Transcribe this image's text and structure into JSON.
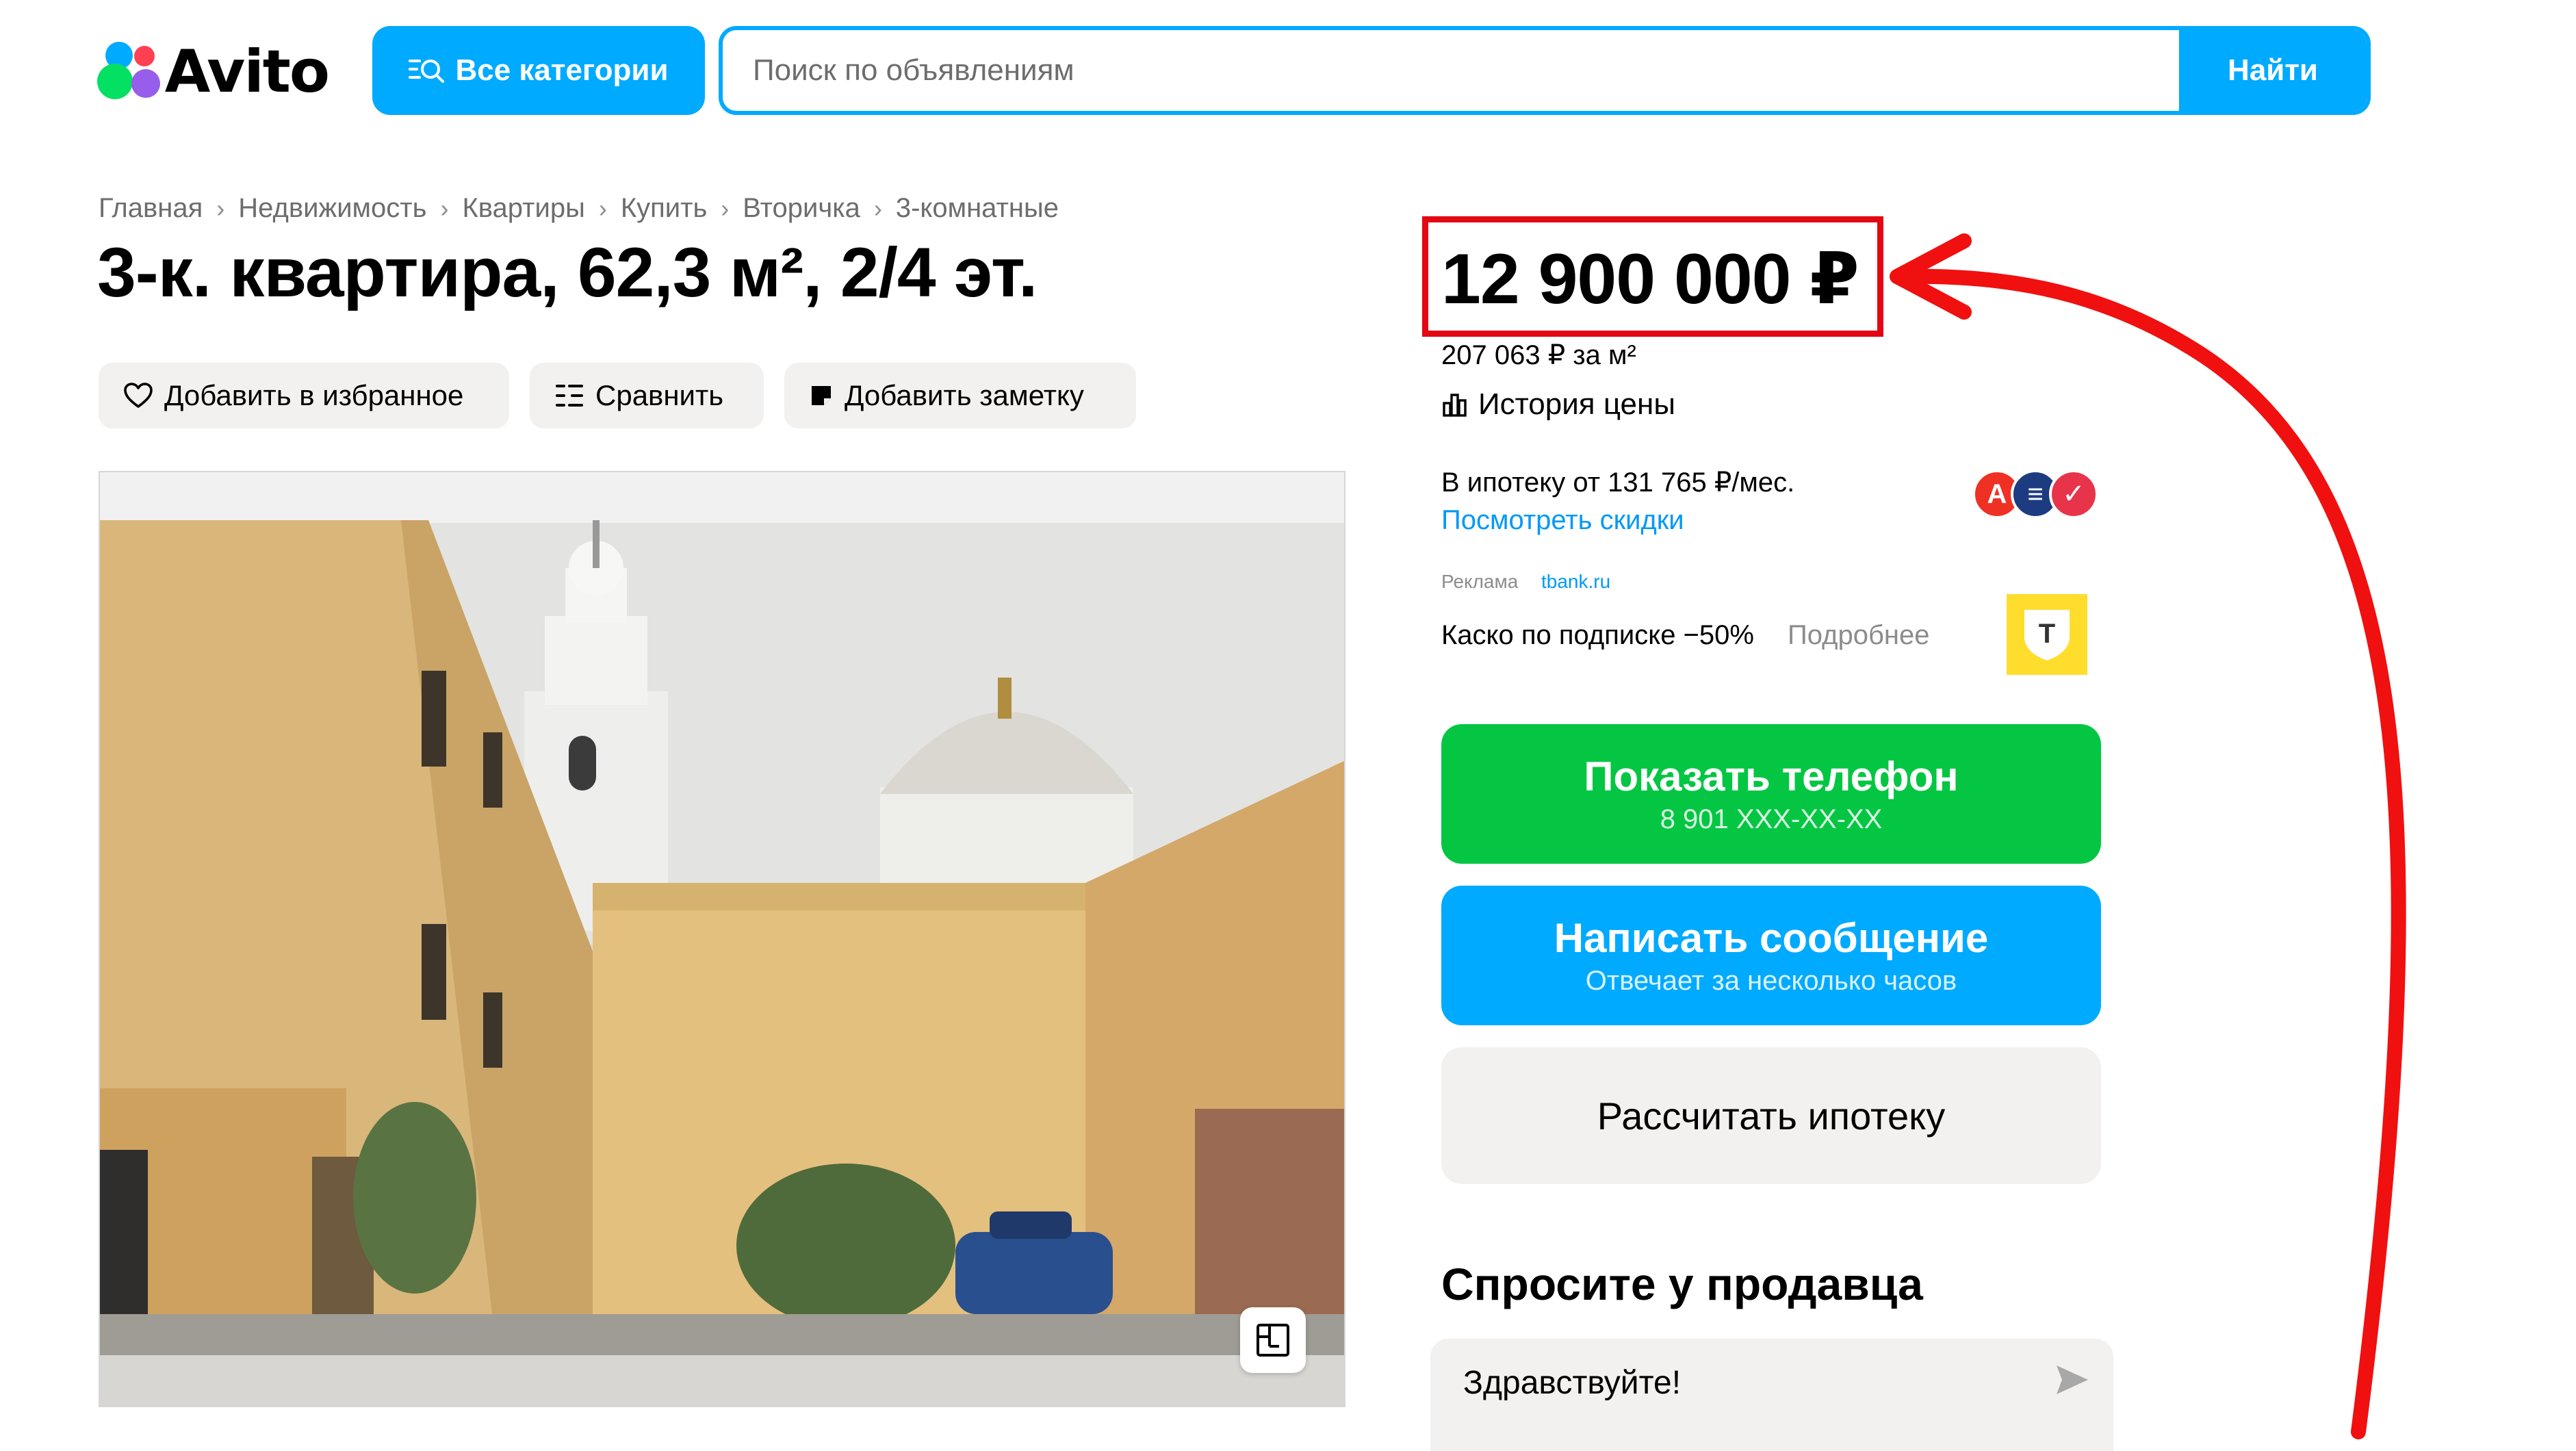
{
  "header": {
    "logo_text": "Avito",
    "categories_label": "Все категории",
    "search": {
      "placeholder": "Поиск по объявлениям",
      "value": ""
    },
    "search_button": "Найти"
  },
  "breadcrumb": [
    "Главная",
    "Недвижимость",
    "Квартиры",
    "Купить",
    "Вторичка",
    "3-комнатные"
  ],
  "breadcrumb_separator": "›",
  "listing": {
    "title": "3-к. квартира, 62,3 м², 2/4 эт.",
    "actions": {
      "favorite": "Добавить в избранное",
      "compare": "Сравнить",
      "note": "Добавить заметку"
    }
  },
  "sidebar": {
    "price": "12 900 000 ₽",
    "price_per_m2": "207 063 ₽ за м²",
    "price_history": "История цены",
    "mortgage": {
      "text": "В ипотеку от 131 765 ₽/мес.",
      "link": "Посмотреть скидки",
      "bank_icons": [
        {
          "letter": "А",
          "color": "#ef3124"
        },
        {
          "letter": "≡",
          "color": "#1c3b80"
        },
        {
          "letter": "✓",
          "color": "#e8344a"
        }
      ]
    },
    "ad": {
      "label": "Реклама",
      "domain": "tbank.ru",
      "text": "Каско по подписке −50%",
      "more": "Подробнее",
      "logo_letter": "Т"
    },
    "phone_button": {
      "label": "Показать телефон",
      "sub": "8 901 XXX-XX-XX"
    },
    "message_button": {
      "label": "Написать сообщение",
      "sub": "Отвечает за несколько часов"
    },
    "mortgage_calc_button": "Рассчитать ипотеку",
    "ask_seller": {
      "title": "Спросите у продавца",
      "input_value": "Здравствуйте!"
    }
  },
  "colors": {
    "brand_blue": "#00aaff",
    "brand_green": "#04c643",
    "highlight_red": "#e30613",
    "button_grey": "#f2f1f0",
    "link_blue": "#0099f7"
  },
  "icons": {
    "categories": "search-icon",
    "favorite": "heart-icon",
    "compare": "compare-icon",
    "note": "note-icon",
    "price_history": "bar-chart-icon",
    "plan": "floor-plan-icon",
    "send": "send-icon"
  }
}
